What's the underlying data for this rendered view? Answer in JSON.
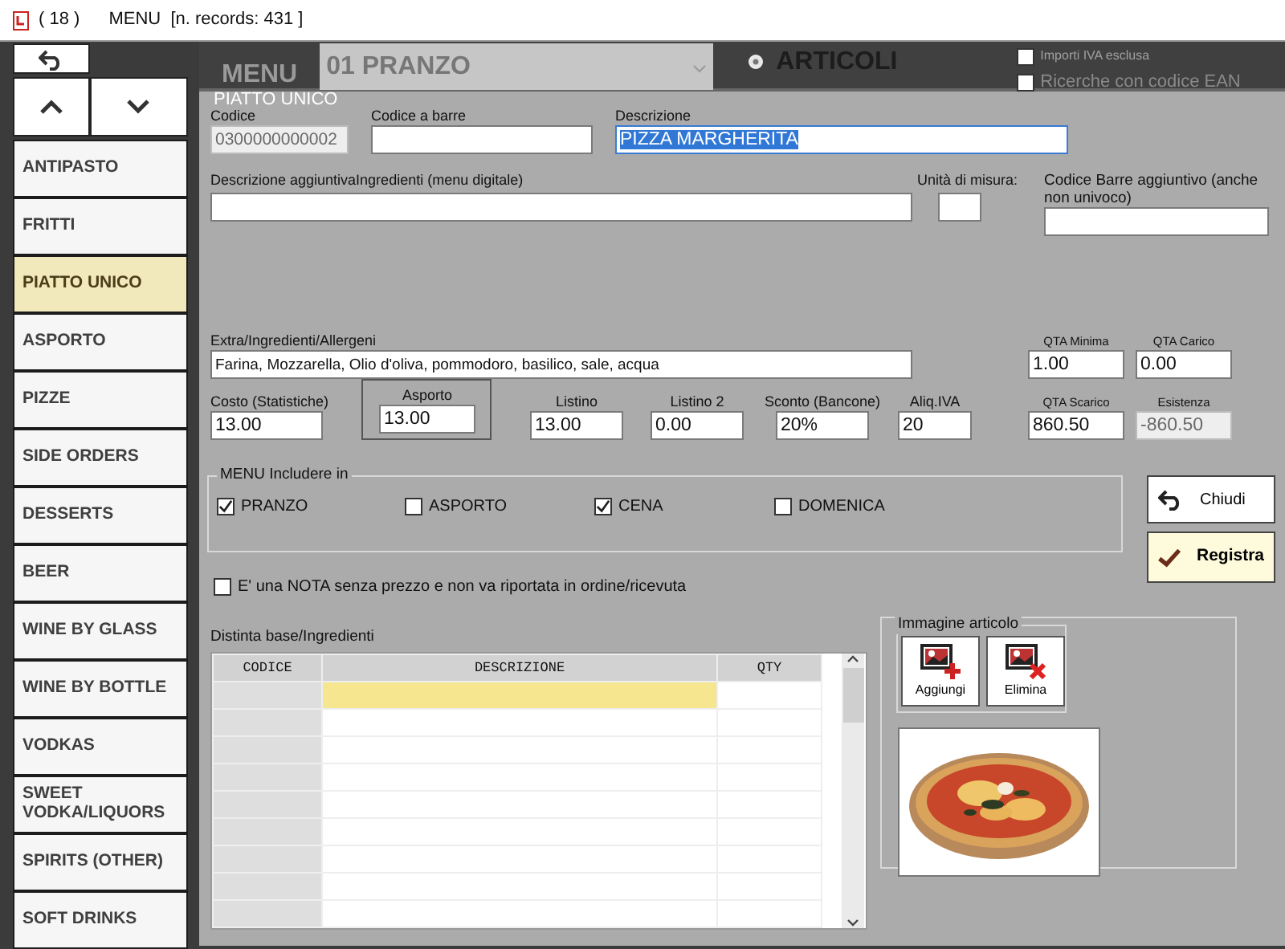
{
  "title_bar": {
    "count": "( 18 )",
    "title": "MENU  [n. records: 431 ]"
  },
  "categories": [
    {
      "label": "ANTIPASTO",
      "selected": false
    },
    {
      "label": "FRITTI",
      "selected": false
    },
    {
      "label": "PIATTO UNICO",
      "selected": true
    },
    {
      "label": "ASPORTO",
      "selected": false
    },
    {
      "label": "PIZZE",
      "selected": false
    },
    {
      "label": "SIDE ORDERS",
      "selected": false
    },
    {
      "label": "DESSERTS",
      "selected": false
    },
    {
      "label": "BEER",
      "selected": false
    },
    {
      "label": "WINE BY GLASS",
      "selected": false
    },
    {
      "label": "WINE BY BOTTLE",
      "selected": false
    },
    {
      "label": "VODKAS",
      "selected": false
    },
    {
      "label": "SWEET VODKA/LIQUORS",
      "selected": false
    },
    {
      "label": "SPIRITS (OTHER)",
      "selected": false
    },
    {
      "label": "SOFT DRINKS",
      "selected": false
    }
  ],
  "header": {
    "title": "MENU",
    "menu_select": "01 PRANZO",
    "radio": {
      "label": "ARTICOLI",
      "selected": true
    },
    "options": [
      {
        "label": "Importi IVA esclusa",
        "checked": false,
        "disabled": true
      },
      {
        "label": "Ricerche con codice EAN",
        "checked": false,
        "disabled": false
      }
    ]
  },
  "form": {
    "legend": "PIATTO UNICO",
    "fields": [
      {
        "label": "Codice",
        "value": "0300000000002",
        "disabled": true,
        "focused": false
      },
      {
        "label": "Codice a barre",
        "disabled": false,
        "focused": false
      },
      {
        "label": "Descrizione",
        "value": "PIZZA MARGHERITA",
        "disabled": false,
        "focused": true
      },
      {
        "label": "Descrizione aggiuntivaIngredienti (menu digitale)",
        "disabled": false,
        "focused": false
      },
      {
        "label": "Unità di misura:",
        "disabled": false,
        "focused": false
      },
      {
        "label": "Codice Barre aggiuntivo (anche non univoco)",
        "disabled": false,
        "focused": false
      },
      {
        "label": "Extra/Ingredienti/Allergeni",
        "value": "Farina, Mozzarella, Olio d'oliva, pommodoro, basilico, sale, acqua",
        "disabled": false,
        "focused": false
      },
      {
        "label": "QTA Minima",
        "value": "1.00",
        "disabled": false,
        "focused": false
      },
      {
        "label": "QTA Carico",
        "value": "0.00",
        "disabled": false,
        "focused": false
      },
      {
        "label": "Costo (Statistiche)",
        "value": "13.00",
        "disabled": false,
        "focused": false
      },
      {
        "label": "Asporto",
        "value": "13.00",
        "disabled": false,
        "focused": false
      },
      {
        "label": "Listino",
        "value": "13.00",
        "disabled": false,
        "focused": false
      },
      {
        "label": "Listino 2",
        "value": "0.00",
        "disabled": false,
        "focused": false
      },
      {
        "label": "Sconto (Bancone)",
        "value": "20%",
        "disabled": false,
        "focused": false
      },
      {
        "label": "Aliq.IVA",
        "value": "20",
        "disabled": false,
        "focused": false
      },
      {
        "label": "QTA Scarico",
        "value": "860.50",
        "disabled": false,
        "focused": false
      },
      {
        "label": "Esistenza",
        "value": "-860.50",
        "disabled": true,
        "focused": false
      }
    ],
    "menu_include": {
      "legend": "MENU Includere in",
      "options": [
        {
          "label": "PRANZO",
          "checked": true
        },
        {
          "label": "ASPORTO",
          "checked": false
        },
        {
          "label": "CENA",
          "checked": true
        },
        {
          "label": "DOMENICA",
          "checked": false
        }
      ]
    },
    "note_option": {
      "label": "E' una NOTA senza prezzo e non va riportata in ordine/ricevuta",
      "checked": false
    },
    "buttons": [
      {
        "label": "Chiudi",
        "kind": "close"
      },
      {
        "label": "Registra",
        "kind": "save"
      }
    ],
    "bom": {
      "label": "Distinta base/Ingredienti",
      "columns": [
        "CODICE",
        "DESCRIZIONE",
        "QTY"
      ],
      "rows": [
        {
          "selected": true
        },
        {
          "selected": false
        },
        {
          "selected": false
        },
        {
          "selected": false
        },
        {
          "selected": false
        },
        {
          "selected": false
        },
        {
          "selected": false
        },
        {
          "selected": false
        },
        {
          "selected": false
        }
      ]
    },
    "image": {
      "legend": "Immagine articolo",
      "buttons": [
        {
          "label": "Aggiungi",
          "kind": "add"
        },
        {
          "label": "Elimina",
          "kind": "remove"
        }
      ],
      "kind": "picture"
    }
  }
}
